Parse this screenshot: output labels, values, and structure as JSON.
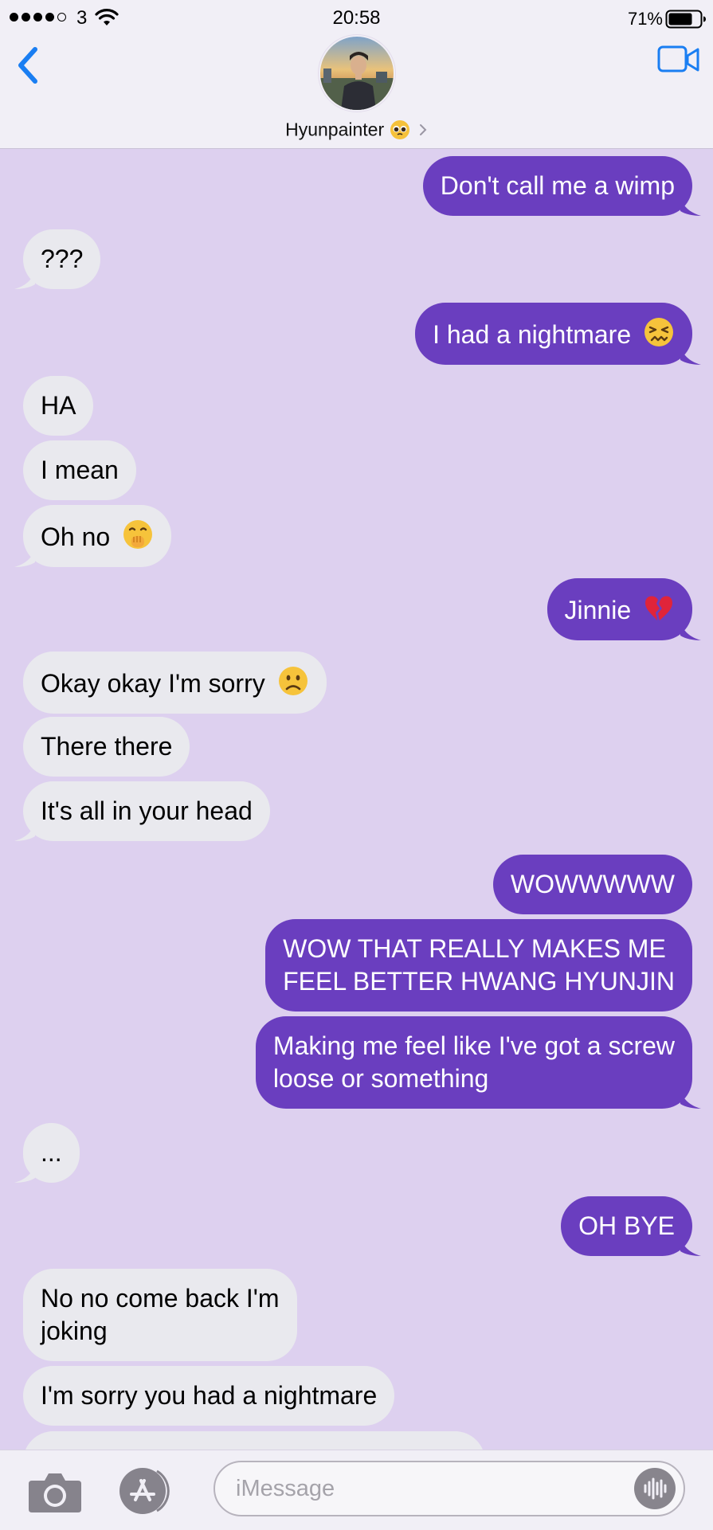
{
  "status_bar": {
    "carrier": "3",
    "time": "20:58",
    "battery_percent": "71%",
    "signal_bars_filled": 4,
    "signal_bars_total": 5
  },
  "header": {
    "contact_name": "Hyunpainter",
    "name_emoji": "pleading-face-emoji"
  },
  "colors": {
    "background": "#ddd0ef",
    "outgoing_bubble": "#6a3ebf",
    "incoming_bubble": "#e9e9ee",
    "accent": "#1a7ef2"
  },
  "messages": [
    {
      "dir": "out",
      "text": "Don't call me a wimp"
    },
    {
      "dir": "in",
      "text": "???"
    },
    {
      "dir": "out",
      "text": "I had a nightmare",
      "emoji": "confounded-face-emoji"
    },
    {
      "dir": "in",
      "text": "HA"
    },
    {
      "dir": "in",
      "text": "I mean"
    },
    {
      "dir": "in",
      "text": "Oh no",
      "emoji": "hand-over-mouth-emoji"
    },
    {
      "dir": "out",
      "text": "Jinnie",
      "emoji": "broken-heart-emoji"
    },
    {
      "dir": "in",
      "text": "Okay okay I'm sorry",
      "emoji": "frowning-face-emoji"
    },
    {
      "dir": "in",
      "text": "There there"
    },
    {
      "dir": "in",
      "text": "It's all in your head"
    },
    {
      "dir": "out",
      "text": "WOWWWWW"
    },
    {
      "dir": "out",
      "lines": [
        "WOW THAT REALLY MAKES ME",
        "FEEL BETTER HWANG HYUNJIN"
      ]
    },
    {
      "dir": "out",
      "lines": [
        "Making me feel like I've got a screw",
        "loose or something"
      ]
    },
    {
      "dir": "in",
      "text": "..."
    },
    {
      "dir": "out",
      "text": "OH BYE"
    },
    {
      "dir": "in",
      "lines": [
        "No no come back I'm",
        "joking"
      ]
    },
    {
      "dir": "in",
      "text": "I'm sorry you had a nightmare"
    }
  ],
  "composer": {
    "placeholder": "iMessage"
  }
}
